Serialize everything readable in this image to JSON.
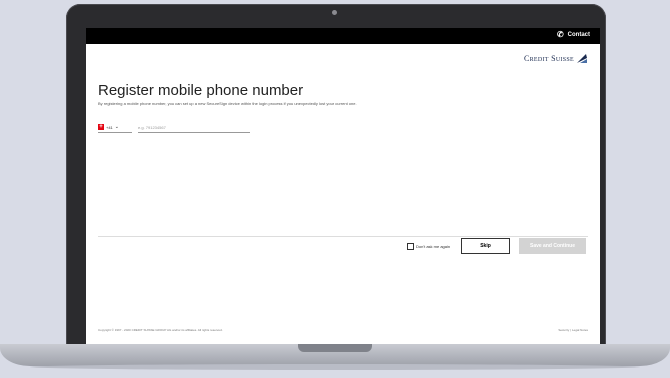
{
  "topbar": {
    "contact_label": "Contact",
    "contact_icon": "phone-icon"
  },
  "brand": {
    "logo_text": "Credit Suisse"
  },
  "page": {
    "title": "Register mobile phone number",
    "subtitle": "By registering a mobile phone number, you can set up a new SecureSign device within the login process if you unexpectedly lost your current one."
  },
  "form": {
    "country_code": "+41",
    "phone_placeholder": "e.g. 791234567"
  },
  "actions": {
    "dont_ask_label": "Don't ask me again",
    "skip_label": "Skip",
    "save_label": "Save and Continue"
  },
  "footer": {
    "copyright": "Copyright © 1997 - 2020 CREDIT SUISSE GROUP AG and/or its affiliates. All rights reserved.",
    "security_link": "Security",
    "separator": "|",
    "legal_link": "Legal Notes"
  },
  "colors": {
    "topbar": "#000000",
    "swiss_red": "#e30613",
    "disabled_button": "#d3d3d3",
    "brand_navy": "#1a2a4f",
    "device_background": "#d8dbe6"
  }
}
